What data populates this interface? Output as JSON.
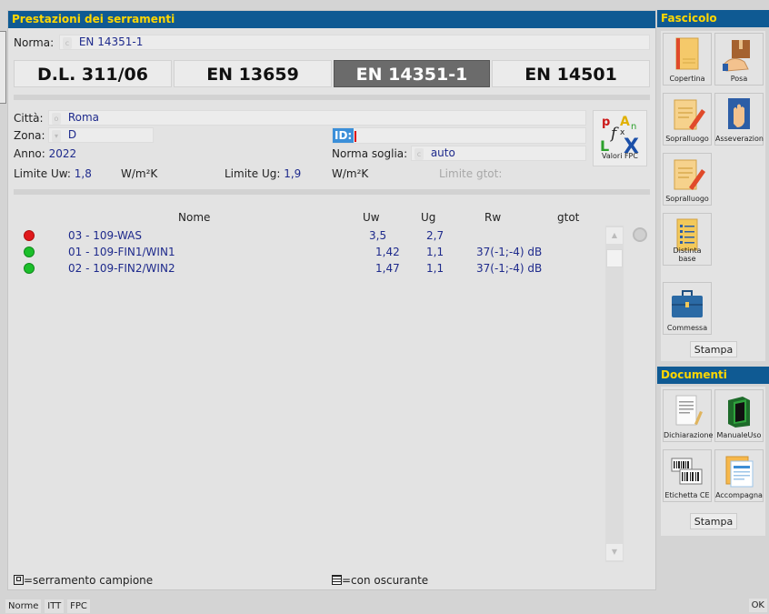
{
  "main": {
    "title": "Prestazioni dei serramenti",
    "norma_label": "Norma:",
    "norma_value": "EN 14351-1",
    "standards": [
      {
        "label": "D.L. 311/06",
        "active": false
      },
      {
        "label": "EN 13659",
        "active": false
      },
      {
        "label": "EN 14351-1",
        "active": true
      },
      {
        "label": "EN 14501",
        "active": false
      }
    ],
    "citta_label": "Città:",
    "citta_value": "Roma",
    "zona_label": "Zona:",
    "zona_value": "D",
    "anno_label": "Anno:",
    "anno_value": "2022",
    "id_label": "ID:",
    "norma_soglia_label": "Norma soglia:",
    "norma_soglia_value": "auto",
    "limite_uw_label": "Limite Uw:",
    "limite_uw_value": "1,8",
    "limite_uw_unit": "W/m²K",
    "limite_ug_label": "Limite Ug:",
    "limite_ug_value": "1,9",
    "limite_ug_unit": "W/m²K",
    "limite_gtot_label": "Limite gtot:",
    "valori_fpc_label": "Valori FPC",
    "table": {
      "headers": [
        "Nome",
        "Uw",
        "Ug",
        "Rw",
        "gtot"
      ],
      "rows": [
        {
          "status": "red",
          "nome": "03 - 109-WAS",
          "uw": "3,5",
          "ug": "2,7",
          "rw": "",
          "gtot": ""
        },
        {
          "status": "green",
          "nome": "01 - 109-FIN1/WIN1",
          "uw": "1,42",
          "ug": "1,1",
          "rw": "37(-1;-4) dB",
          "gtot": ""
        },
        {
          "status": "green",
          "nome": "02 - 109-FIN2/WIN2",
          "uw": "1,47",
          "ug": "1,1",
          "rw": "37(-1;-4) dB",
          "gtot": ""
        }
      ]
    },
    "legend_campione": "=serramento campione",
    "legend_oscurante": "=con oscurante"
  },
  "fascicolo": {
    "title": "Fascicolo",
    "tiles": [
      "Copertina",
      "Posa",
      "Sopralluogo",
      "Asseverazion",
      "Sopralluogo",
      "Distinta base",
      "Commessa"
    ],
    "stampa_label": "Stampa"
  },
  "documenti": {
    "title": "Documenti",
    "tiles": [
      "Dichiarazione",
      "ManualeUso",
      "Etichetta CE",
      "Accompagna"
    ],
    "stampa_label": "Stampa"
  },
  "statusbar": {
    "buttons": [
      "Norme",
      "ITT",
      "FPC"
    ],
    "ok_label": "OK"
  },
  "colors": {
    "titlebar_bg": "#0f5a93",
    "titlebar_text": "#ffd700",
    "value_text": "#1e2a8c",
    "status_red": "#e0191c",
    "status_green": "#1bbf2a",
    "active_standard": "#6b6b6b"
  }
}
